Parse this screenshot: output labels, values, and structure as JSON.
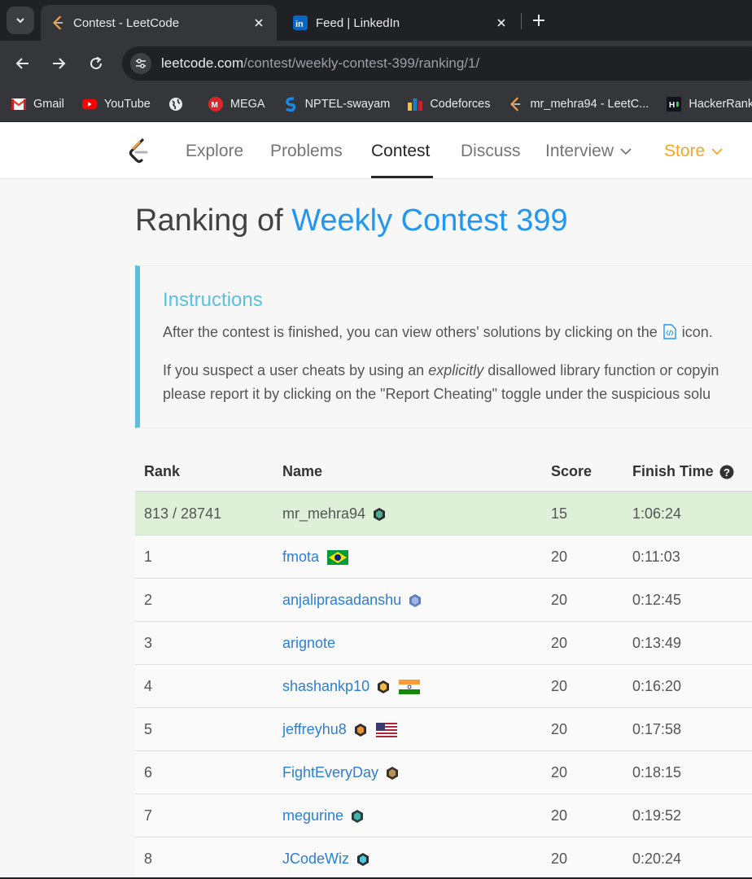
{
  "browser": {
    "tabs": [
      {
        "title": "Contest - LeetCode",
        "active": true,
        "icon": "leetcode-icon"
      },
      {
        "title": "Feed | LinkedIn",
        "active": false,
        "icon": "linkedin-icon"
      }
    ],
    "url_host": "leetcode.com",
    "url_path": "/contest/weekly-contest-399/ranking/1/",
    "bookmarks": [
      {
        "label": "Gmail",
        "icon": "gmail-icon"
      },
      {
        "label": "YouTube",
        "icon": "youtube-icon"
      },
      {
        "label": "",
        "icon": "globe-icon"
      },
      {
        "label": "MEGA",
        "icon": "mega-icon"
      },
      {
        "label": "NPTEL-swayam",
        "icon": "nptel-icon"
      },
      {
        "label": "Codeforces",
        "icon": "codeforces-icon"
      },
      {
        "label": "mr_mehra94 - LeetC...",
        "icon": "leetcode-icon"
      },
      {
        "label": "HackerRank-ch",
        "icon": "hackerrank-icon"
      }
    ]
  },
  "nav": {
    "items": [
      "Explore",
      "Problems",
      "Contest",
      "Discuss",
      "Interview",
      "Store"
    ],
    "active": "Contest",
    "accent": "#f5a623"
  },
  "page": {
    "title_prefix": "Ranking of",
    "contest_name": "Weekly Contest 399",
    "title_color": "#2196f3"
  },
  "instructions": {
    "title": "Instructions",
    "p1_before": "After the contest is finished, you can view others' solutions by clicking on the",
    "p1_after": "icon.",
    "p2_line1_before": "If you suspect a user cheats by using an",
    "p2_line1_em": "explicitly",
    "p2_line1_after": "disallowed library function or copyin",
    "p2_line2": "please report it by clicking on the \"Report Cheating\" toggle under the suspicious solu"
  },
  "table": {
    "headers": {
      "rank": "Rank",
      "name": "Name",
      "score": "Score",
      "finish_time": "Finish Time"
    },
    "me": {
      "rank": "813 / 28741",
      "name": "mr_mehra94",
      "score": "15",
      "time": "1:06:24"
    },
    "rows": [
      {
        "rank": "1",
        "name": "fmota",
        "score": "20",
        "time": "0:11:03",
        "badge": "",
        "flag": "brazil"
      },
      {
        "rank": "2",
        "name": "anjaliprasadanshu",
        "score": "20",
        "time": "0:12:45",
        "badge": "blue",
        "flag": ""
      },
      {
        "rank": "3",
        "name": "arignote",
        "score": "20",
        "time": "0:13:49",
        "badge": "",
        "flag": ""
      },
      {
        "rank": "4",
        "name": "shashankp10",
        "score": "20",
        "time": "0:16:20",
        "badge": "gold",
        "flag": "india"
      },
      {
        "rank": "5",
        "name": "jeffreyhu8",
        "score": "20",
        "time": "0:17:58",
        "badge": "orange",
        "flag": "usa"
      },
      {
        "rank": "6",
        "name": "FightEveryDay",
        "score": "20",
        "time": "0:18:15",
        "badge": "bronze",
        "flag": ""
      },
      {
        "rank": "7",
        "name": "megurine",
        "score": "20",
        "time": "0:19:52",
        "badge": "teal",
        "flag": ""
      },
      {
        "rank": "8",
        "name": "JCodeWiz",
        "score": "20",
        "time": "0:20:24",
        "badge": "cyan",
        "flag": ""
      }
    ]
  }
}
